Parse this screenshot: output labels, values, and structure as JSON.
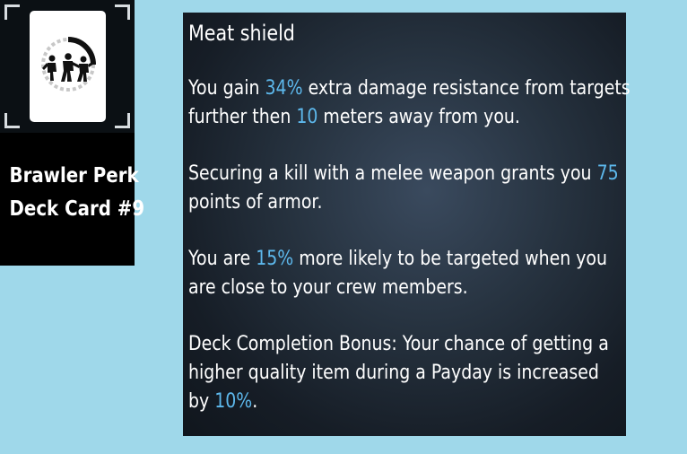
{
  "card": {
    "icon": "brawlers-icon",
    "caption_line1": "Brawler Perk",
    "caption_line2": "Deck Card #9"
  },
  "tooltip": {
    "title": "Meat shield",
    "p1": {
      "a": "You gain ",
      "v1": "34%",
      "b": " extra damage resistance from targets",
      "c": "further then ",
      "v2": "10",
      "d": " meters away from you."
    },
    "p2": {
      "a": "Securing a kill with a melee weapon grants you ",
      "v1": "75",
      "b": "points of armor."
    },
    "p3": {
      "a": "You are ",
      "v1": "15%",
      "b": " more likely to be targeted when you",
      "c": "are close to your crew members."
    },
    "p4": {
      "a": "Deck Completion Bonus: Your chance of getting a",
      "b": "higher quality item during a Payday is increased",
      "c": "by ",
      "v1": "10%",
      "d": "."
    }
  },
  "colors": {
    "highlight": "#5db8ec",
    "background": "#9fd8ea"
  }
}
